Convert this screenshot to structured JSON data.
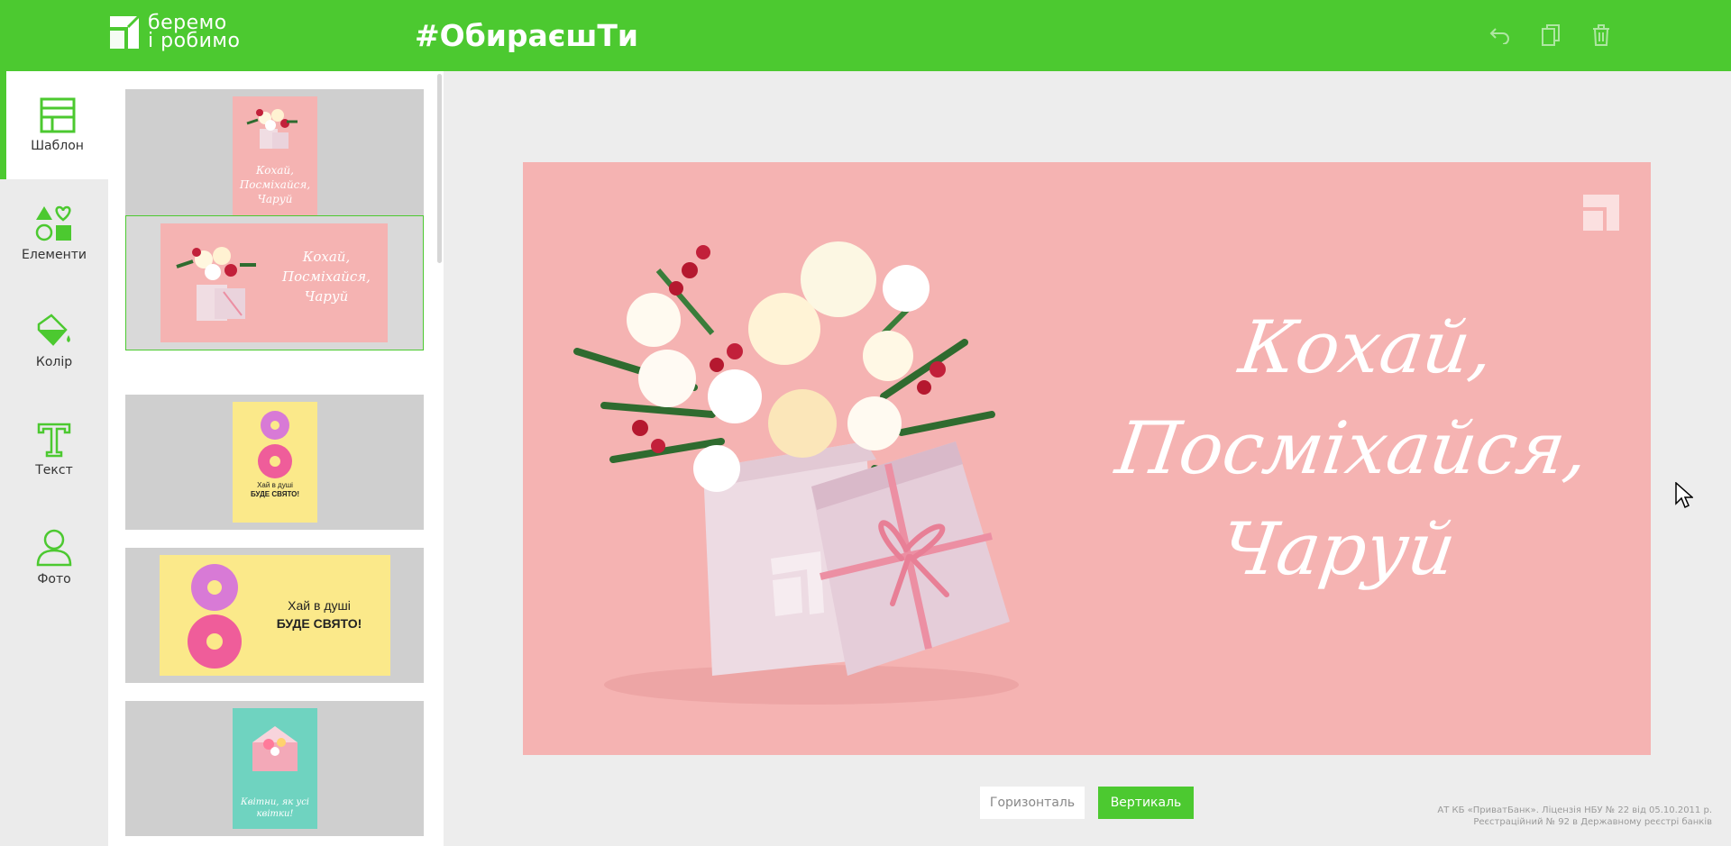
{
  "header": {
    "logo_line1": "беремо",
    "logo_line2": "і робимо",
    "hashtag": "#ОбираєшТи",
    "actions": [
      {
        "icon": "undo-icon"
      },
      {
        "icon": "copy-icon"
      },
      {
        "icon": "trash-icon"
      }
    ]
  },
  "tools": [
    {
      "label": "Шаблон",
      "icon": "template-icon",
      "active": true
    },
    {
      "label": "Елементи",
      "icon": "shapes-icon",
      "active": false
    },
    {
      "label": "Колір",
      "icon": "paint-bucket-icon",
      "active": false
    },
    {
      "label": "Текст",
      "icon": "text-icon",
      "active": false
    },
    {
      "label": "Фото",
      "icon": "person-icon",
      "active": false
    }
  ],
  "templates": [
    {
      "orientation": "vertical",
      "text": "Кохай, Посміхайся, Чаруй",
      "background": "#f5b3b2",
      "selected": false
    },
    {
      "orientation": "horizontal",
      "text": "Кохай, Посміхайся, Чаруй",
      "background": "#f5b3b2",
      "selected": true
    },
    {
      "orientation": "vertical",
      "text_line1": "Хай в душі",
      "text_line2": "БУДЕ СВЯТО!",
      "background": "#fbe98a",
      "selected": false
    },
    {
      "orientation": "horizontal",
      "text_line1": "Хай в душі",
      "text_line2": "БУДЕ СВЯТО!",
      "background": "#fbe98a",
      "selected": false
    },
    {
      "orientation": "vertical",
      "text": "Квітни, як усі квітки!",
      "background": "#6fd3c0",
      "selected": false
    }
  ],
  "card": {
    "title_line1": "Кохай,",
    "title_line2": "Посміхайся,",
    "title_line3": "Чаруй",
    "background": "#f5b3b2"
  },
  "orientation_buttons": {
    "horizontal": "Горизонталь",
    "vertical": "Вертикаль"
  },
  "legal": {
    "line1": "АТ КБ «ПриватБанк». Ліцензія НБУ № 22 від 05.10.2011 р.",
    "line2": "Реєстраційний № 92 в Державному реєстрі банків"
  },
  "colors": {
    "accent": "#4cc930",
    "card_pink": "#f5b3b2",
    "donut_yellow": "#fbe98a",
    "mint": "#6fd3c0"
  }
}
